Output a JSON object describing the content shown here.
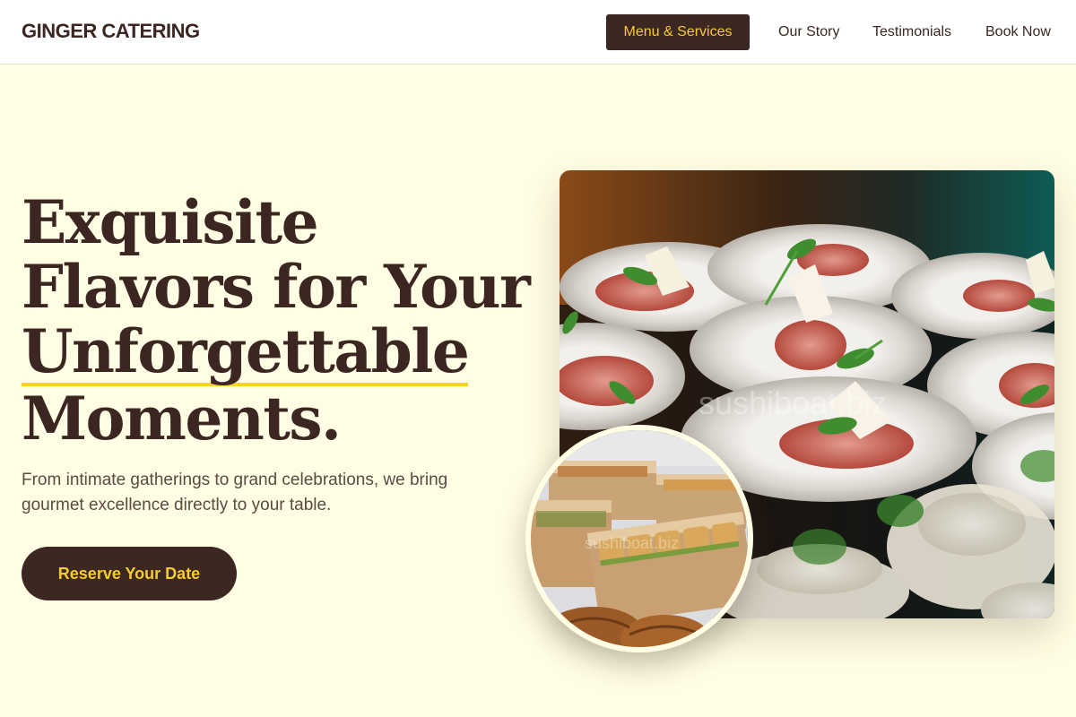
{
  "header": {
    "brand": "GINGER CATERING",
    "nav": {
      "menu_services": "Menu & Services",
      "our_story": "Our Story",
      "testimonials": "Testimonials",
      "book_now": "Book Now"
    }
  },
  "hero": {
    "headline": {
      "line1": "Exquisite",
      "line2": "Flavors for Your",
      "line3": "Unforgettable",
      "line4": "Moments."
    },
    "subtext": "From intimate gatherings to grand celebrations, we bring gourmet excellence directly to your table.",
    "cta_label": "Reserve Your Date",
    "main_image_watermark": "sushiboat.biz",
    "round_image_watermark": "sushiboat.biz"
  },
  "colors": {
    "page_bg": "#fffde3",
    "brown": "#3d2723",
    "gold": "#f5cc2c",
    "underline": "#f5d329"
  },
  "images": {
    "main": "food-platter-image",
    "round": "boxed-sandwiches-image"
  }
}
